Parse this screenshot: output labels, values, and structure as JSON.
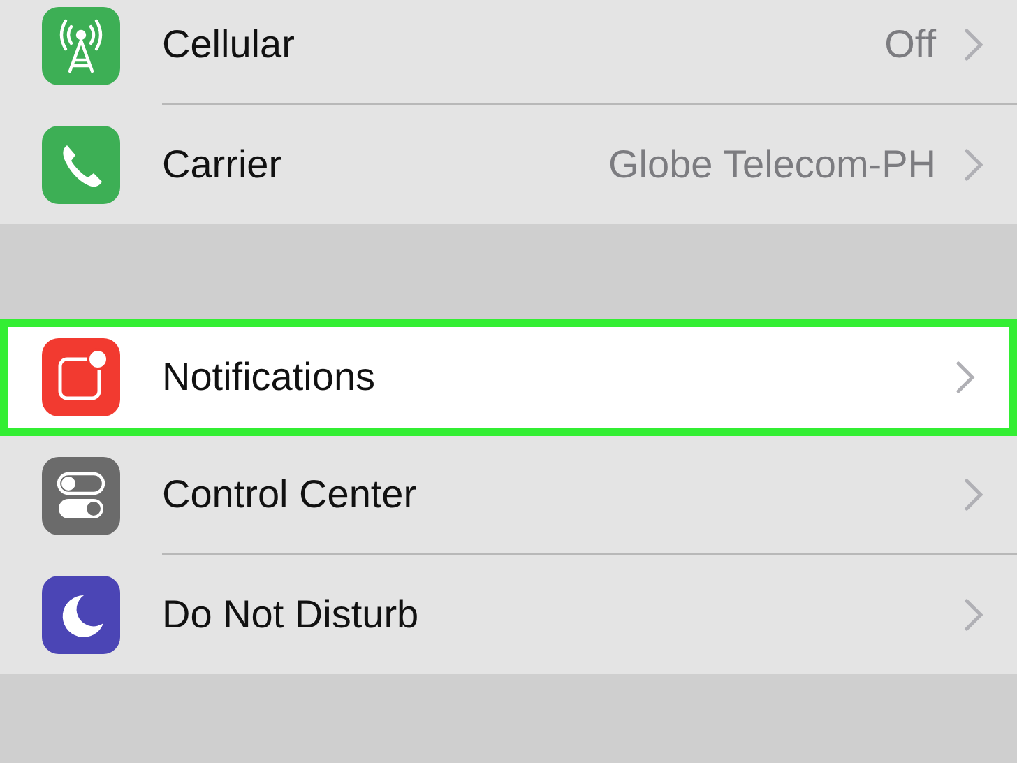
{
  "groups": [
    {
      "rows": [
        {
          "kind": "cellular",
          "label": "Cellular",
          "value": "Off",
          "highlighted": false
        },
        {
          "kind": "carrier",
          "label": "Carrier",
          "value": "Globe Telecom-PH",
          "highlighted": false
        }
      ]
    },
    {
      "rows": [
        {
          "kind": "notifications",
          "label": "Notifications",
          "highlighted": true
        },
        {
          "kind": "control-center",
          "label": "Control Center",
          "highlighted": false
        },
        {
          "kind": "do-not-disturb",
          "label": "Do Not Disturb",
          "highlighted": false
        }
      ]
    }
  ]
}
